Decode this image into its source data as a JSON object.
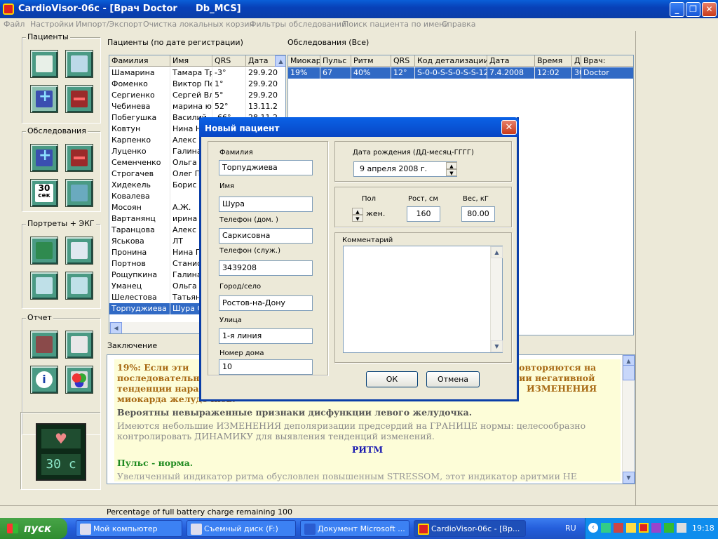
{
  "window": {
    "title": "CardioVisor-06c - [Врач Doctor",
    "db": "Db_MCS]"
  },
  "menu": [
    "Файл",
    "Настройки",
    "Импорт/Экспорт",
    "Очистка локальных корзин",
    "Фильтры обследований",
    "Поиск пациента по имени",
    "Справка"
  ],
  "groups": {
    "patients": "Пациенты",
    "exams": "Обследования",
    "portraits": "Портреты + ЭКГ",
    "report": "Отчет"
  },
  "timer_button": {
    "line1": "30",
    "line2": "сек"
  },
  "heart_timer": "30 c",
  "patients_panel": {
    "label": "Пациенты  (по дате регистрации)",
    "headers": [
      "Фамилия",
      "Имя",
      "QRS",
      "Дата"
    ],
    "rows": [
      [
        "Шамарина",
        "Тамара Тр",
        "-3°",
        "29.9.20"
      ],
      [
        "Фоменко",
        "Виктор Пе",
        "1°",
        "29.9.20"
      ],
      [
        "Сергиенко",
        "Сергей Вл",
        "5°",
        "29.9.20"
      ],
      [
        "Чебинева",
        "марина юр",
        "52°",
        "13.11.2"
      ],
      [
        "Побегушка",
        "Василий",
        "-66°",
        "28.11.2"
      ],
      [
        "Ковтун",
        "Нина Н",
        "",
        ""
      ],
      [
        "Карпенко",
        "Алекс",
        "",
        ""
      ],
      [
        "Луценко",
        "Галина",
        "",
        ""
      ],
      [
        "Семенченко",
        "Ольга",
        "",
        ""
      ],
      [
        "Строгачев",
        "Олег П",
        "",
        ""
      ],
      [
        "Хидекель",
        "Борис",
        "",
        ""
      ],
      [
        "Ковалева",
        "",
        "",
        ""
      ],
      [
        "Мосоян",
        "А.Ж.",
        "",
        ""
      ],
      [
        "Вартанянц",
        "ирина В",
        "",
        ""
      ],
      [
        "Таранцова",
        "Алекс",
        "",
        ""
      ],
      [
        "Яськова",
        "ЛТ",
        "",
        ""
      ],
      [
        "Пронина",
        "Нина П",
        "",
        ""
      ],
      [
        "Портнов",
        "Станис",
        "",
        ""
      ],
      [
        "Рощупкина",
        "Галина",
        "",
        ""
      ],
      [
        "Уманец",
        "Ольга",
        "",
        ""
      ],
      [
        "Шелестова",
        "Татьян",
        "",
        ""
      ],
      [
        "Торпуджиева",
        "Шура С",
        "",
        ""
      ]
    ]
  },
  "exams_panel": {
    "label": "Обследования   (Все)",
    "headers": [
      "Миокар",
      "Пульс",
      "Ритм",
      "QRS",
      "Код детализации",
      "Дата",
      "Время",
      "Д",
      "Врач:"
    ],
    "rows": [
      [
        "19%",
        "67",
        "40%",
        "12°",
        "S-0-0-S-S-0-S-S-12",
        "7.4.2008",
        "12:02",
        "30",
        "Doctor"
      ]
    ]
  },
  "conclusion": {
    "label": "Заключение",
    "p1a": "19%:   Если  эти",
    "p1b": "повторяются на",
    "p2a": "последовательны",
    "p2b": "нии негативной",
    "p3a": "тенденции нараст",
    "p3b": "ИЗМЕНЕНИЯ",
    "p4": "миокарда желудочков.",
    "p5": "Вероятны невыраженные признаки  дисфункции  левого желудочка.",
    "p6": "Имеются небольшие ИЗМЕНЕНИЯ деполяризации предсердий на ГРАНИЦЕ  нормы:  целесообразно контролировать  ДИНАМИКУ  для выявления  тенденций  изменений.",
    "p7": "РИТМ",
    "p8": "Пульс - норма.",
    "p9": "Увеличенный индикатор ритма обусловлен повышенным STRESSOM, этот индикатор аритмии НЕ"
  },
  "status": "Percentage of full battery charge remaining 100",
  "taskbar": {
    "start": "пуск",
    "tasks": [
      "Мой компьютер",
      "Съемный диск (F:)",
      "Документ Microsoft ...",
      "CardioVisor-06c - [Вр..."
    ],
    "lang": "RU",
    "clock": "19:18"
  },
  "dialog": {
    "title": "Новый пациент",
    "surname_label": "Фамилия",
    "surname": "Торпуджиева",
    "name_label": "Имя",
    "name": "Шура",
    "phone_home_label": "Телефон (дом. )",
    "phone_home": "Саркисовна",
    "phone_work_label": "Телефон (служ.)",
    "phone_work": "3439208",
    "city_label": "Город/село",
    "city": "Ростов-на-Дону",
    "street_label": "Улица",
    "street": "1-я линия",
    "house_label": "Номер дома",
    "house": "10",
    "dob_label": "Дата рождения (ДД-месяц-ГГГГ)",
    "dob": "9  апреля  2008 г.",
    "sex_label": "Пол",
    "sex": "жен.",
    "height_label": "Рост, см",
    "height": "160",
    "weight_label": "Вес, кГ",
    "weight": "80.00",
    "comment_label": "Комментарий",
    "comment": "",
    "ok": "ОК",
    "cancel": "Отмена"
  }
}
